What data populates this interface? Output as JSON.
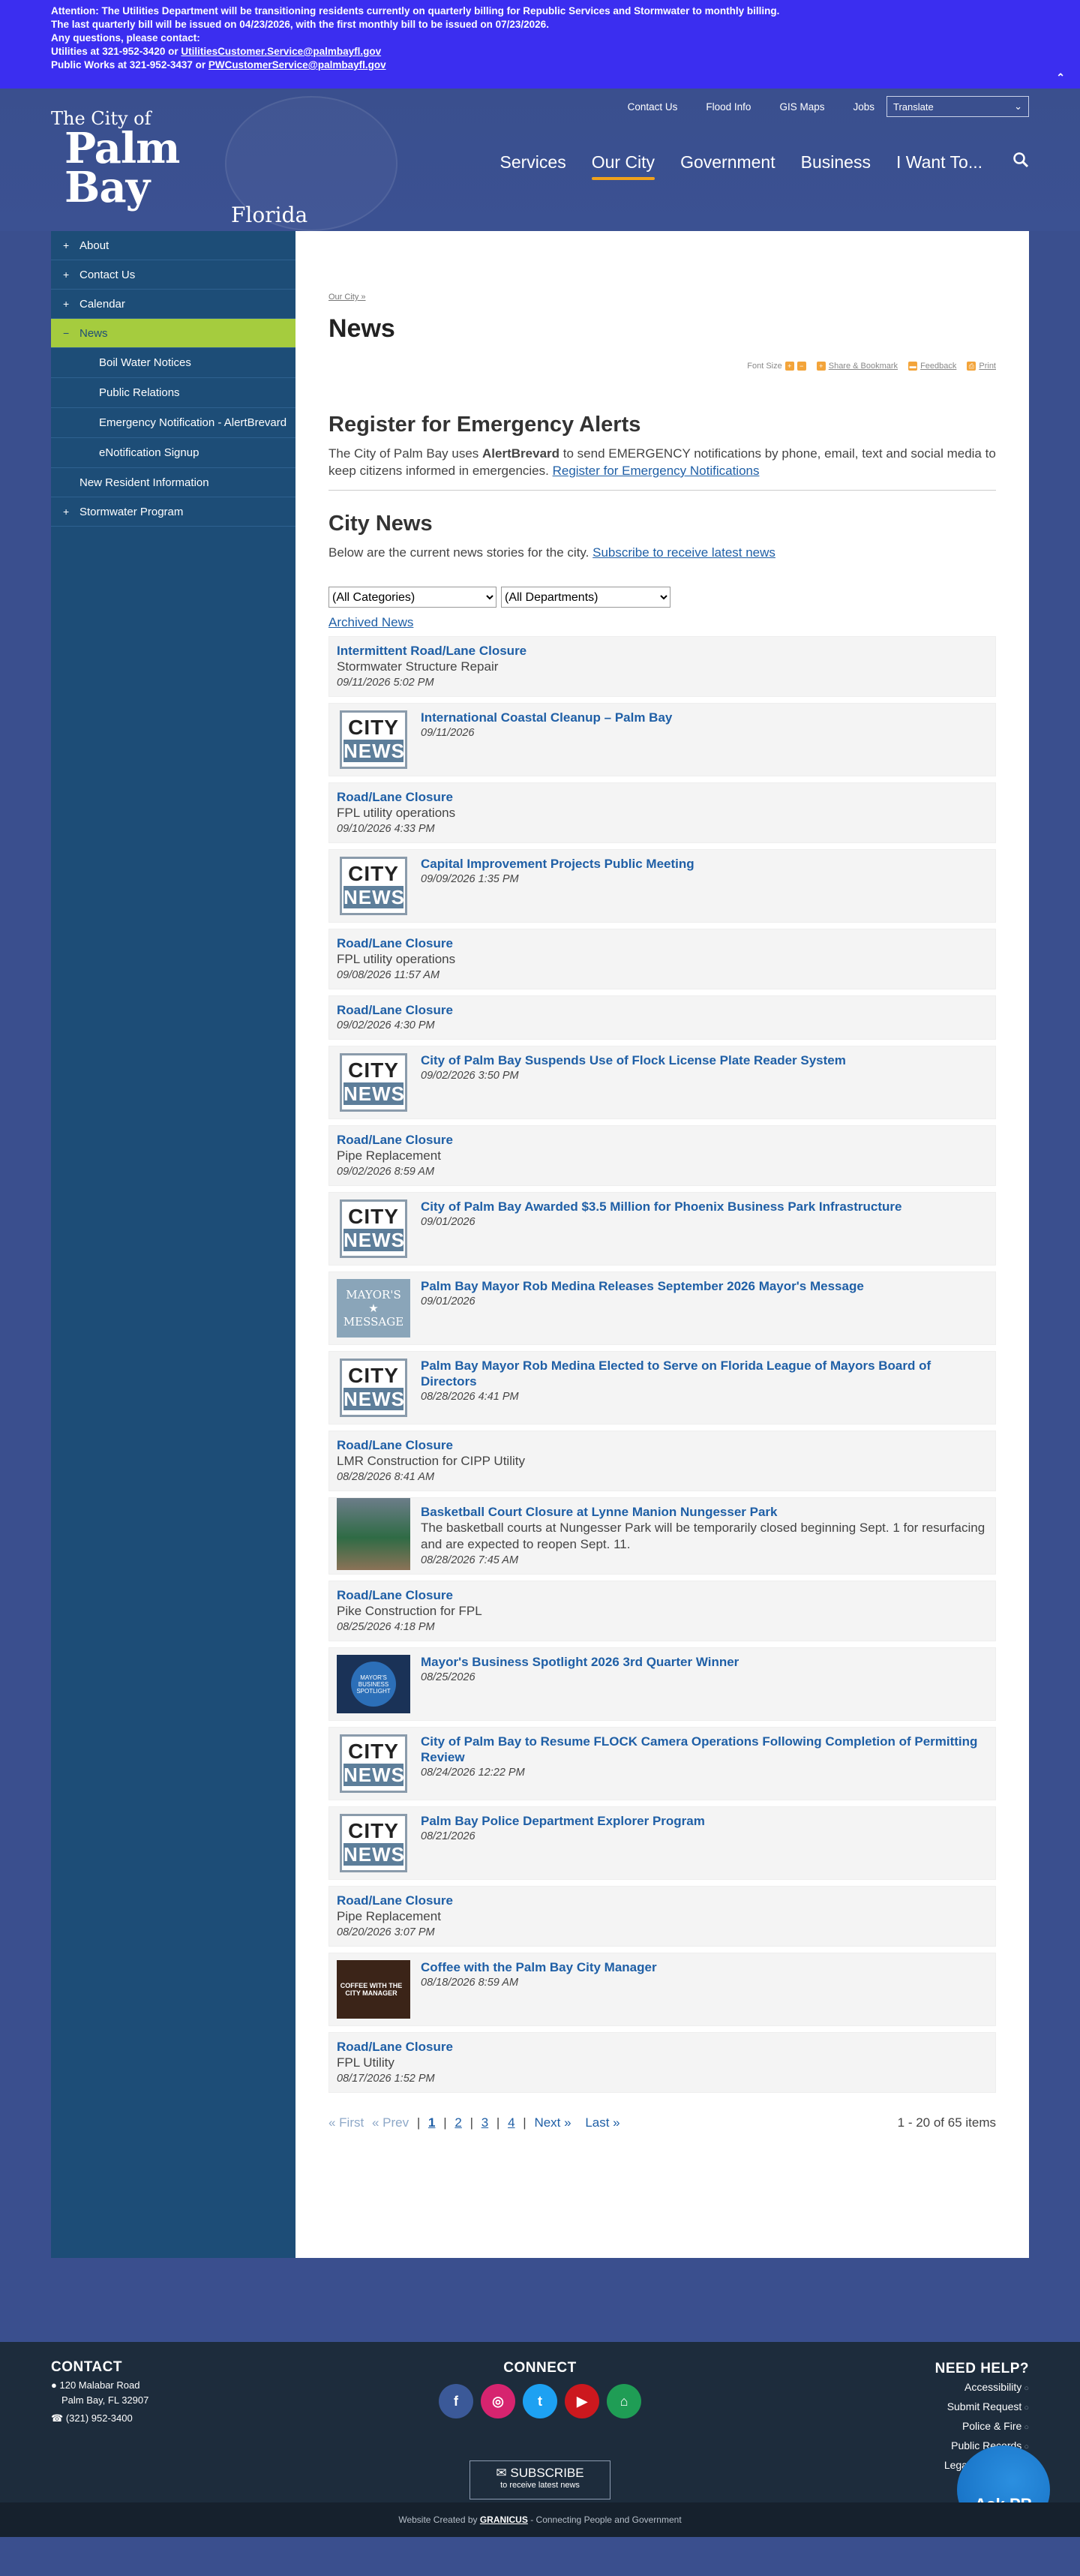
{
  "alert": {
    "line1": "Attention: The Utilities Department will be transitioning residents currently on quarterly billing for Republic Services and Stormwater to monthly billing.",
    "line2": "The last quarterly bill will be issued on 04/23/2026, with the first monthly bill to be issued on 07/23/2026.",
    "line3": "Any questions, please contact:",
    "line4_text": "Utilities at 321-952-3420 or ",
    "line4_link": "UtilitiesCustomer.Service@palmbayfl.gov",
    "line5_text": "Public Works at 321-952-3437 or ",
    "line5_link": "PWCustomerService@palmbayfl.gov",
    "collapse_icon": "double-chevron-up-icon"
  },
  "logo": {
    "line1": "The City of",
    "line2": "Palm Bay",
    "line3": "Florida"
  },
  "utility_nav": [
    "Contact Us",
    "Flood Info",
    "GIS Maps",
    "Jobs"
  ],
  "translate_label": "Translate",
  "main_nav": [
    "Services",
    "Our City",
    "Government",
    "Business",
    "I Want To..."
  ],
  "sidebar": {
    "items": [
      {
        "pm": "+",
        "label": "About"
      },
      {
        "pm": "+",
        "label": "Contact Us"
      },
      {
        "pm": "+",
        "label": "Calendar"
      },
      {
        "pm": "−",
        "label": "News"
      }
    ],
    "subitems": [
      "Boil Water Notices",
      "Public Relations",
      "Emergency Notification - AlertBrevard",
      "eNotification Signup"
    ],
    "plain": "New Resident Information",
    "last": {
      "pm": "+",
      "label": "Stormwater Program"
    }
  },
  "breadcrumb": "Our City »",
  "page_title": "News",
  "tools": {
    "font_size": "Font Size",
    "share": "Share & Bookmark",
    "feedback": "Feedback",
    "print": "Print"
  },
  "alerts_section": {
    "heading": "Register for Emergency Alerts",
    "text_before": "The City of Palm Bay uses ",
    "bold": "AlertBrevard",
    "text_after": " to send EMERGENCY notifications by phone, email, text and social media to keep citizens informed in emergencies. ",
    "link": "Register for Emergency Notifications"
  },
  "news_section": {
    "heading": "City News",
    "text": "Below are the current news stories for the city. ",
    "link": "Subscribe to receive latest news",
    "filter_categories": "(All Categories)",
    "filter_departments": "(All Departments)",
    "archived": "Archived News"
  },
  "news": [
    {
      "img": "",
      "title": "Intermittent Road/Lane Closure",
      "desc": "Stormwater Structure Repair",
      "date": "09/11/2026 5:02 PM"
    },
    {
      "img": "city",
      "title": "International Coastal Cleanup – Palm Bay",
      "desc": "",
      "date": "09/11/2026"
    },
    {
      "img": "",
      "title": "Road/Lane Closure",
      "desc": "FPL utility operations",
      "date": "09/10/2026 4:33 PM"
    },
    {
      "img": "city",
      "title": "Capital Improvement Projects Public Meeting",
      "desc": "",
      "date": "09/09/2026 1:35 PM"
    },
    {
      "img": "",
      "title": "Road/Lane Closure",
      "desc": "FPL utility operations",
      "date": "09/08/2026 11:57 AM"
    },
    {
      "img": "",
      "title": "Road/Lane Closure",
      "desc": "",
      "date": "09/02/2026 4:30 PM"
    },
    {
      "img": "city",
      "title": "City of Palm Bay Suspends Use of Flock License Plate Reader System",
      "desc": "",
      "date": "09/02/2026 3:50 PM"
    },
    {
      "img": "",
      "title": "Road/Lane Closure",
      "desc": "Pipe Replacement",
      "date": "09/02/2026 8:59 AM"
    },
    {
      "img": "city",
      "title": "City of Palm Bay Awarded $3.5 Million for Phoenix Business Park Infrastructure",
      "desc": "",
      "date": "09/01/2026"
    },
    {
      "img": "mayor",
      "title": "Palm Bay Mayor Rob Medina Releases September 2026 Mayor's Message",
      "desc": "",
      "date": "09/01/2026"
    },
    {
      "img": "city",
      "title": "Palm Bay Mayor Rob Medina Elected to Serve on Florida League of Mayors Board of Directors",
      "desc": "",
      "date": "08/28/2026 4:41 PM"
    },
    {
      "img": "",
      "title": "Road/Lane Closure",
      "desc": "LMR Construction for CIPP Utility",
      "date": "08/28/2026 8:41 AM"
    },
    {
      "img": "photo",
      "title": "Basketball Court Closure at Lynne Manion Nungesser Park",
      "desc": "The basketball courts at Nungesser Park will be temporarily closed beginning Sept. 1 for resurfacing and are expected to reopen Sept. 11.",
      "date": "08/28/2026 7:45 AM"
    },
    {
      "img": "",
      "title": "Road/Lane Closure",
      "desc": "Pike Construction for FPL",
      "date": "08/25/2026 4:18 PM"
    },
    {
      "img": "badge",
      "title": "Mayor's Business Spotlight 2026 3rd Quarter Winner",
      "desc": "",
      "date": "08/25/2026"
    },
    {
      "img": "city",
      "title": "City of Palm Bay to Resume FLOCK Camera Operations Following Completion of Permitting Review",
      "desc": "",
      "date": "08/24/2026 12:22 PM"
    },
    {
      "img": "city",
      "title": "Palm Bay Police Department Explorer Program",
      "desc": "",
      "date": "08/21/2026"
    },
    {
      "img": "",
      "title": "Road/Lane Closure",
      "desc": "Pipe Replacement",
      "date": "08/20/2026 3:07 PM"
    },
    {
      "img": "coffee",
      "title": "Coffee with the Palm Bay City Manager",
      "desc": "",
      "date": "08/18/2026 8:59 AM"
    },
    {
      "img": "",
      "title": "Road/Lane Closure",
      "desc": "FPL Utility",
      "date": "08/17/2026 1:52 PM"
    }
  ],
  "thumb_text": {
    "city": "CITY",
    "news": "NEWS",
    "mayor1": "MAYOR'S",
    "mayor2": "MESSAGE",
    "badge": "MAYOR'S BUSINESS SPOTLIGHT",
    "coffee": "COFFEE WITH THE CITY MANAGER"
  },
  "pager": {
    "first": "« First",
    "prev": "« Prev",
    "pages": [
      "1",
      "2",
      "3",
      "4"
    ],
    "next": "Next »",
    "last": "Last »",
    "count": "1 - 20 of 65 items"
  },
  "footer": {
    "contact_heading": "CONTACT",
    "address1": "120 Malabar Road",
    "address2": "Palm Bay, FL 32907",
    "phone": "(321) 952-3400",
    "connect_heading": "CONNECT",
    "social": [
      {
        "icon": "facebook-icon",
        "glyph": "f",
        "color": "#3b5998"
      },
      {
        "icon": "instagram-icon",
        "glyph": "◎",
        "color": "#d6246f"
      },
      {
        "icon": "twitter-icon",
        "glyph": "t",
        "color": "#1da1f2"
      },
      {
        "icon": "youtube-icon",
        "glyph": "▶",
        "color": "#cc181e"
      },
      {
        "icon": "nextdoor-icon",
        "glyph": "⌂",
        "color": "#1f9d55"
      }
    ],
    "subscribe_title": "SUBSCRIBE",
    "subscribe_sub": "to receive latest news",
    "help_heading": "NEED HELP?",
    "help_links": [
      "Accessibility",
      "Submit Request",
      "Police & Fire",
      "Public Records",
      "Legal Disclaimer"
    ],
    "credit_before": "Website Created by ",
    "credit_brand": "GRANICUS",
    "credit_after": " - Connecting People and Government",
    "ask": "Ask PB"
  }
}
